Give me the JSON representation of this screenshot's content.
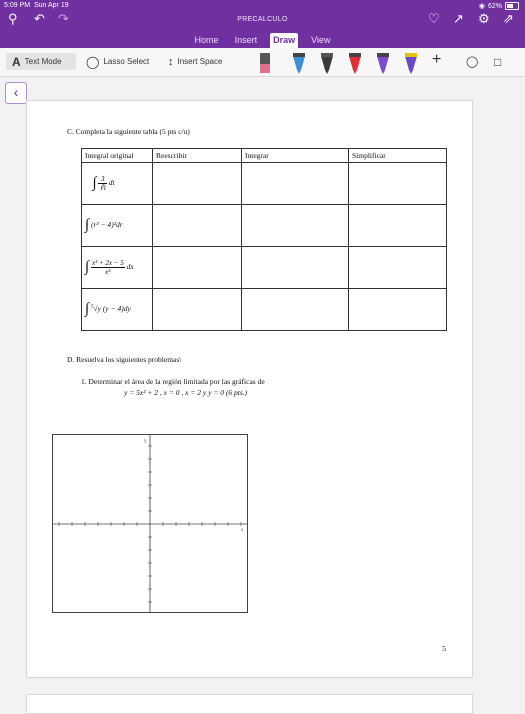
{
  "status": {
    "time": "5:09 PM",
    "date": "Sun Apr 19",
    "battery": "62%"
  },
  "app": {
    "title": "PRECALCULO"
  },
  "tabs": [
    {
      "label": "Home",
      "active": false
    },
    {
      "label": "Insert",
      "active": false
    },
    {
      "label": "Draw",
      "active": true
    },
    {
      "label": "View",
      "active": false
    }
  ],
  "ribbon": {
    "text_mode": "Text Mode",
    "lasso_select": "Lasso Select",
    "insert_space": "Insert Space",
    "pens": [
      "#e0708f",
      "#3a8fd8",
      "#3a3a3a",
      "#e03030",
      "#7b4bd4",
      "#6a4ac8"
    ]
  },
  "colors": {
    "accent": "#7030a0"
  },
  "section_c": {
    "heading": "C.  Completa la siguiente tabla   (5 pts c/u)",
    "headers": [
      "Integral original",
      "Reescribir",
      "Integrar",
      "Simplificar"
    ],
    "rows": [
      {
        "original": "∫ 3/∛t dt"
      },
      {
        "original": "∫ (r³ − 4)² dr"
      },
      {
        "original": "∫ (x³ + 2x − 5)/x⁵ dx"
      },
      {
        "original": "∫ ⁵√y (y − 4) dy"
      }
    ]
  },
  "section_d": {
    "heading": "D.  Resuelva los siguientes problemas\\",
    "problem1": "1.   Determinar el área de la región limitada por las gráficas de",
    "equation": "y = 5x² + 2 ,  x = 0 ,  x = 2   y  y = 0    (6 pts.)"
  },
  "graph": {
    "x_label": "x",
    "y_label": "y"
  },
  "page_number": "5"
}
